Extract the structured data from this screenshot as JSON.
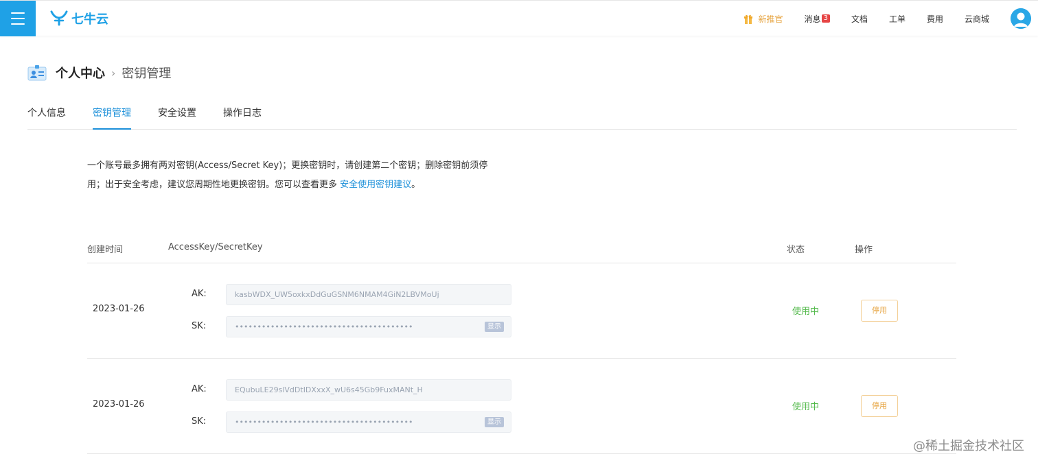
{
  "header": {
    "logo_text": "七牛云",
    "brand_color": "#1fa1e6",
    "nav": {
      "promo": "新推官",
      "messages": "消息",
      "messages_count": "3",
      "docs": "文档",
      "tickets": "工单",
      "billing": "费用",
      "marketplace": "云商城"
    }
  },
  "breadcrumb": {
    "root": "个人中心",
    "separator": ">",
    "current": "密钥管理"
  },
  "tabs": [
    {
      "label": "个人信息",
      "active": false
    },
    {
      "label": "密钥管理",
      "active": true
    },
    {
      "label": "安全设置",
      "active": false
    },
    {
      "label": "操作日志",
      "active": false
    }
  ],
  "description": {
    "text_line1": "一个账号最多拥有两对密钥(Access/Secret Key)；更换密钥时，请创建第二个密钥；删除密钥前须停",
    "text_line2": "用；出于安全考虑，建议您周期性地更换密钥。您可以查看更多 ",
    "link": "安全使用密钥建议",
    "suffix": "。"
  },
  "table": {
    "headers": {
      "created": "创建时间",
      "keys": "AccessKey/SecretKey",
      "status": "状态",
      "actions": "操作"
    },
    "ak_label": "AK:",
    "sk_label": "SK:",
    "show_label": "显示",
    "rows": [
      {
        "date": "2023-01-26",
        "ak": "kasbWDX_UW5oxkxDdGuGSNM6NMAM4GiN2LBVMoUj",
        "sk": "••••••••••••••••••••••••••••••••••••••••",
        "status": "使用中",
        "action": "停用"
      },
      {
        "date": "2023-01-26",
        "ak": "EQubuLE29slVdDtIDXxxX_wU6s45Gb9FuxMANt_H",
        "sk": "••••••••••••••••••••••••••••••••••••••••",
        "status": "使用中",
        "action": "停用"
      }
    ]
  },
  "watermark": "@稀土掘金技术社区",
  "colors": {
    "accent": "#1b8fd9",
    "status_active": "#52b94a",
    "warning": "#e6a23c"
  }
}
